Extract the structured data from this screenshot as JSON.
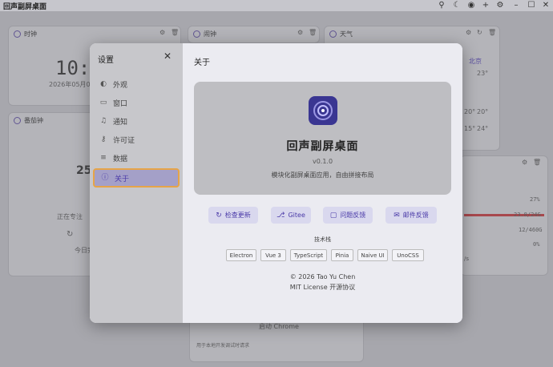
{
  "window": {
    "title": "回声副屏桌面",
    "controls": [
      "pin-icon",
      "moon-icon",
      "eye-icon",
      "plus-icon",
      "gear-icon",
      "minimize-icon",
      "maximize-icon",
      "close-icon"
    ]
  },
  "background": {
    "clock": {
      "title": "时钟",
      "time": "10:",
      "date": "2026年05月06"
    },
    "alarm": {
      "title": "闹钟"
    },
    "weather": {
      "title": "天气",
      "city": "北京",
      "temp": "23°",
      "temps": [
        "20°",
        "20°",
        "15°",
        "24°"
      ]
    },
    "pomodoro": {
      "title": "番茄钟",
      "count": "25",
      "focus": "正在专注",
      "today": "今日完"
    },
    "system": {
      "values": [
        "27%",
        "23.8/24G",
        "12/460G",
        "0%"
      ],
      "unit": "/s"
    },
    "chrome": {
      "title": "启动 Chrome",
      "hint": "用于本地开发调试时请求"
    }
  },
  "modal": {
    "sidebar_title": "设置",
    "sidebar_items": [
      {
        "label": "外观",
        "icon": "palette-icon"
      },
      {
        "label": "窗口",
        "icon": "monitor-icon"
      },
      {
        "label": "通知",
        "icon": "bell-icon"
      },
      {
        "label": "许可证",
        "icon": "key-icon"
      },
      {
        "label": "数据",
        "icon": "database-icon"
      },
      {
        "label": "关于",
        "icon": "info-icon",
        "active": true
      }
    ],
    "content_title": "关于",
    "app_name": "回声副屏桌面",
    "version": "v0.1.0",
    "description": "模块化副屏桌面应用，自由拼接布局",
    "actions": [
      {
        "label": "检查更新",
        "icon": "refresh-icon"
      },
      {
        "label": "Gitee",
        "icon": "gitee-icon"
      },
      {
        "label": "问题反馈",
        "icon": "chat-icon"
      },
      {
        "label": "邮件反馈",
        "icon": "mail-icon"
      }
    ],
    "tech_label": "技术栈",
    "tech": [
      "Electron",
      "Vue 3",
      "TypeScript",
      "Pinia",
      "Naive UI",
      "UnoCSS"
    ],
    "copyright": "© 2026 Tao Yu Chen",
    "license": "MIT License 开源协议"
  },
  "colors": {
    "accent": "#4a3aa8",
    "active_border": "#e6a448",
    "app_icon_bg": "#3a3692"
  }
}
